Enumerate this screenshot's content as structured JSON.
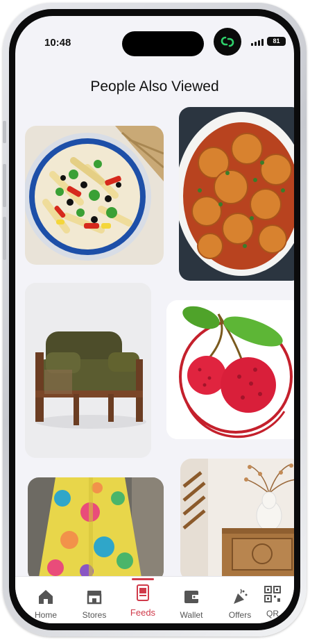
{
  "status_bar": {
    "time": "10:48",
    "battery": "81"
  },
  "page": {
    "title": "People Also Viewed"
  },
  "feed_items": [
    {
      "name": "pasta-salad-bowl",
      "image": "pasta-salad-image"
    },
    {
      "name": "kofta-curry-bowl",
      "image": "kofta-curry-image"
    },
    {
      "name": "green-velvet-armchair",
      "image": "armchair-image"
    },
    {
      "name": "lychee-logo",
      "image": "lychee-image"
    },
    {
      "name": "printed-fabric-dress",
      "image": "dress-image"
    },
    {
      "name": "carved-wood-side-table",
      "image": "side-table-image"
    }
  ],
  "bottom_nav": {
    "items": [
      {
        "label": "Home",
        "icon": "home-icon"
      },
      {
        "label": "Stores",
        "icon": "store-icon"
      },
      {
        "label": "Feeds",
        "icon": "feeds-icon",
        "active": true
      },
      {
        "label": "Wallet",
        "icon": "wallet-icon"
      },
      {
        "label": "Offers",
        "icon": "offers-icon"
      },
      {
        "label": "QR",
        "icon": "qr-icon"
      }
    ],
    "active_color": "#d03a4a"
  }
}
